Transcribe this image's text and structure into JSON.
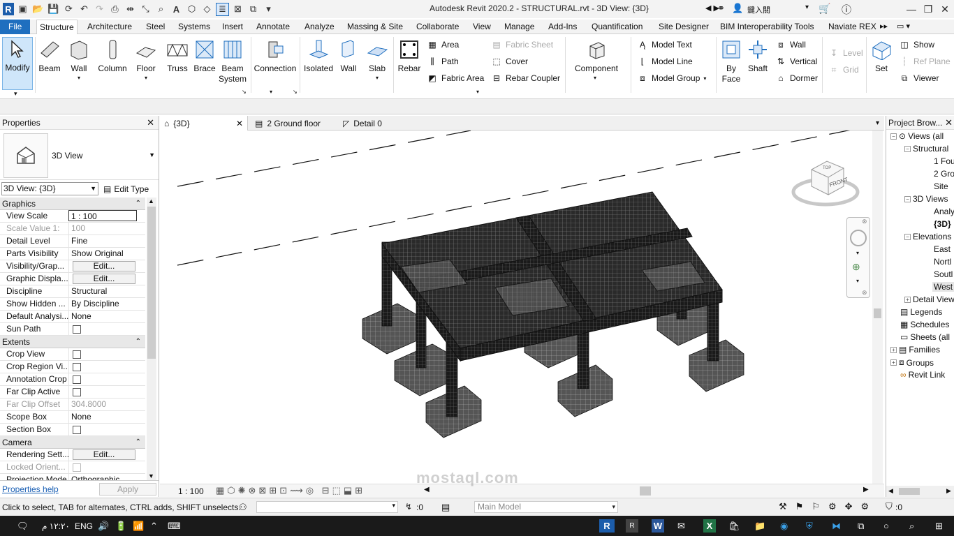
{
  "app": {
    "title": "Autodesk Revit 2020.2 - STRUCTURAL.rvt - 3D View: {3D}",
    "search_hint": "鍵入關",
    "logo": "R"
  },
  "menu_tabs": [
    "File",
    "Structure",
    "Architecture",
    "Steel",
    "Systems",
    "Insert",
    "Annotate",
    "Analyze",
    "Massing & Site",
    "Collaborate",
    "View",
    "Manage",
    "Add-Ins",
    "Quantification",
    "Site Designer",
    "BIM Interoperability Tools",
    "Naviate REX"
  ],
  "ribbon": {
    "modify": "Modify",
    "beam": "Beam",
    "wall": "Wall",
    "column": "Column",
    "floor": "Floor",
    "truss": "Truss",
    "brace": "Brace",
    "beam_system": "Beam System",
    "connection": "Connection",
    "isolated": "Isolated",
    "wall_found": "Wall",
    "slab": "Slab",
    "rebar": "Rebar",
    "area": "Area",
    "path": "Path",
    "fabric_area": "Fabric  Area",
    "fabric_sheet": "Fabric  Sheet",
    "cover": "Cover",
    "rebar_coupler": "Rebar  Coupler",
    "component": "Component",
    "model_text": "Model  Text",
    "model_line": "Model  Line",
    "model_group": "Model  Group",
    "by_face": "By Face",
    "shaft": "Shaft",
    "open_wall": "Wall",
    "vertical": "Vertical",
    "dormer": "Dormer",
    "level": "Level",
    "grid": "Grid",
    "set": "Set",
    "show": "Show",
    "ref_plane": "Ref  Plane",
    "viewer": "Viewer"
  },
  "properties": {
    "title": "Properties",
    "type_name": "3D View",
    "view_selector": "3D View: {3D}",
    "edit_type": "Edit Type",
    "groups": {
      "graphics": "Graphics",
      "extents": "Extents",
      "camera": "Camera"
    },
    "rows": {
      "view_scale": {
        "k": "View Scale",
        "v": "1 : 100"
      },
      "scale_value": {
        "k": "Scale Value    1:",
        "v": "100"
      },
      "detail_level": {
        "k": "Detail Level",
        "v": "Fine"
      },
      "parts_visibility": {
        "k": "Parts Visibility",
        "v": "Show Original"
      },
      "visibility": {
        "k": "Visibility/Grap...",
        "v": "Edit..."
      },
      "graphic_display": {
        "k": "Graphic Displa...",
        "v": "Edit..."
      },
      "discipline": {
        "k": "Discipline",
        "v": "Structural"
      },
      "show_hidden": {
        "k": "Show Hidden ...",
        "v": "By Discipline"
      },
      "default_analysis": {
        "k": "Default Analysi...",
        "v": "None"
      },
      "sun_path": {
        "k": "Sun Path",
        "v": ""
      },
      "crop_view": {
        "k": "Crop View",
        "v": ""
      },
      "crop_region": {
        "k": "Crop Region Vi...",
        "v": ""
      },
      "annotation_crop": {
        "k": "Annotation Crop",
        "v": ""
      },
      "far_clip_active": {
        "k": "Far Clip Active",
        "v": ""
      },
      "far_clip_offset": {
        "k": "Far Clip Offset",
        "v": "304.8000"
      },
      "scope_box": {
        "k": "Scope Box",
        "v": "None"
      },
      "section_box": {
        "k": "Section Box",
        "v": ""
      },
      "rendering": {
        "k": "Rendering Sett...",
        "v": "Edit..."
      },
      "locked_orient": {
        "k": "Locked Orient...",
        "v": ""
      },
      "projection": {
        "k": "Projection Mode",
        "v": "Orthographic"
      }
    },
    "help": "Properties help",
    "apply": "Apply"
  },
  "views": {
    "tabs": [
      {
        "label": "{3D}"
      },
      {
        "label": "2 Ground floor"
      },
      {
        "label": "Detail 0"
      }
    ],
    "scale": "1 : 100",
    "viewcube": {
      "top": "TOP",
      "front": "FRONT"
    }
  },
  "project_browser": {
    "title": "Project Brow...",
    "nodes": [
      "Views (all",
      "Structural",
      "1 Fou",
      "2 Gro",
      "Site",
      "3D Views",
      "Analy",
      "{3D}",
      "Elevations",
      "East",
      "Nortl",
      "Soutl",
      "West",
      "Detail View",
      "Legends",
      "Schedules",
      "Sheets (all",
      "Families",
      "Groups",
      "Revit Link"
    ]
  },
  "status": {
    "text": "Click to select, TAB for alternates, CTRL adds, SHIFT unselects.",
    "workset": ":0",
    "model": "Main Model",
    "filter": ":0"
  },
  "taskbar": {
    "time": "١٢:٢٠ م",
    "lang": "ENG"
  },
  "watermark": "mostaql.com",
  "colors": {
    "file_tab": "#1f6fbf",
    "modify_active": "#cfe6fa",
    "link": "#1a5fb4"
  }
}
